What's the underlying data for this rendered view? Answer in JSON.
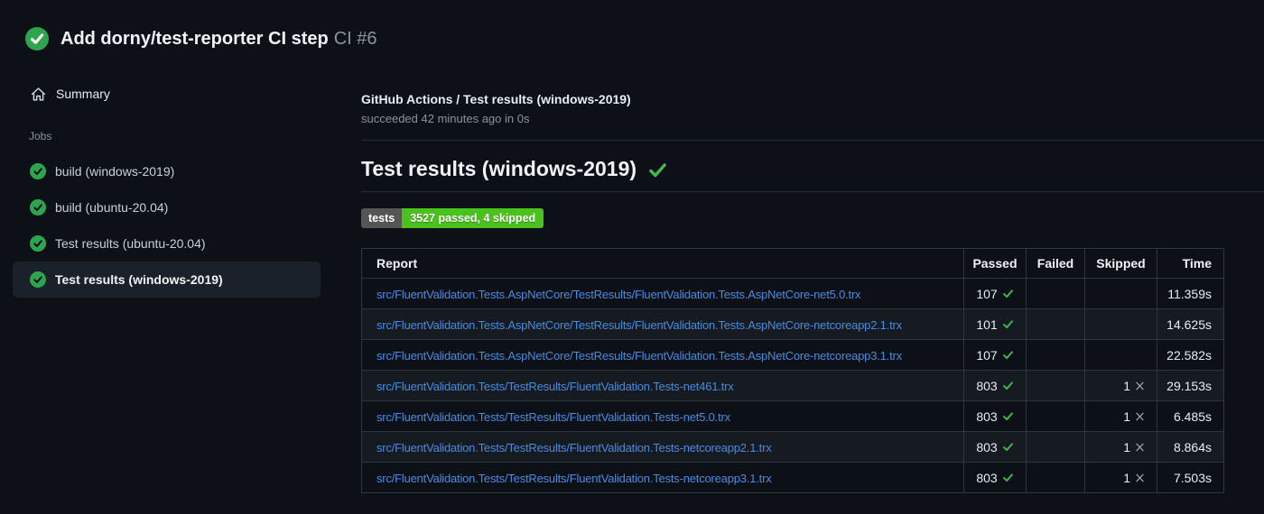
{
  "header": {
    "title": "Add dorny/test-reporter CI step",
    "run_number": "CI #6"
  },
  "sidebar": {
    "summary_label": "Summary",
    "jobs_label": "Jobs",
    "jobs": [
      {
        "label": "build (windows-2019)",
        "status": "success",
        "selected": false
      },
      {
        "label": "build (ubuntu-20.04)",
        "status": "success",
        "selected": false
      },
      {
        "label": "Test results (ubuntu-20.04)",
        "status": "success",
        "selected": false
      },
      {
        "label": "Test results (windows-2019)",
        "status": "success",
        "selected": true
      }
    ]
  },
  "main": {
    "check_run_title": "GitHub Actions / Test results (windows-2019)",
    "check_run_status": "succeeded 42 minutes ago in 0s",
    "heading": "Test results (windows-2019)",
    "badge": {
      "label": "tests",
      "value": "3527 passed, 4 skipped"
    },
    "table": {
      "headers": [
        "Report",
        "Passed",
        "Failed",
        "Skipped",
        "Time"
      ],
      "rows": [
        {
          "report": "src/FluentValidation.Tests.AspNetCore/TestResults/FluentValidation.Tests.AspNetCore-net5.0.trx",
          "passed": "107",
          "failed": "",
          "skipped": "",
          "time": "11.359s"
        },
        {
          "report": "src/FluentValidation.Tests.AspNetCore/TestResults/FluentValidation.Tests.AspNetCore-netcoreapp2.1.trx",
          "passed": "101",
          "failed": "",
          "skipped": "",
          "time": "14.625s"
        },
        {
          "report": "src/FluentValidation.Tests.AspNetCore/TestResults/FluentValidation.Tests.AspNetCore-netcoreapp3.1.trx",
          "passed": "107",
          "failed": "",
          "skipped": "",
          "time": "22.582s"
        },
        {
          "report": "src/FluentValidation.Tests/TestResults/FluentValidation.Tests-net461.trx",
          "passed": "803",
          "failed": "",
          "skipped": "1",
          "time": "29.153s"
        },
        {
          "report": "src/FluentValidation.Tests/TestResults/FluentValidation.Tests-net5.0.trx",
          "passed": "803",
          "failed": "",
          "skipped": "1",
          "time": "6.485s"
        },
        {
          "report": "src/FluentValidation.Tests/TestResults/FluentValidation.Tests-netcoreapp2.1.trx",
          "passed": "803",
          "failed": "",
          "skipped": "1",
          "time": "8.864s"
        },
        {
          "report": "src/FluentValidation.Tests/TestResults/FluentValidation.Tests-netcoreapp3.1.trx",
          "passed": "803",
          "failed": "",
          "skipped": "1",
          "time": "7.503s"
        }
      ]
    }
  },
  "colors": {
    "background": "#0d1117",
    "row_alt": "#161b22",
    "border": "#30363d",
    "success_circle": "#2da44e",
    "success_check": "#3fb950",
    "link_blue": "#478be0",
    "badge_label_bg": "#555555",
    "badge_value_bg": "#4ac21d",
    "muted_text": "#8b949e"
  }
}
